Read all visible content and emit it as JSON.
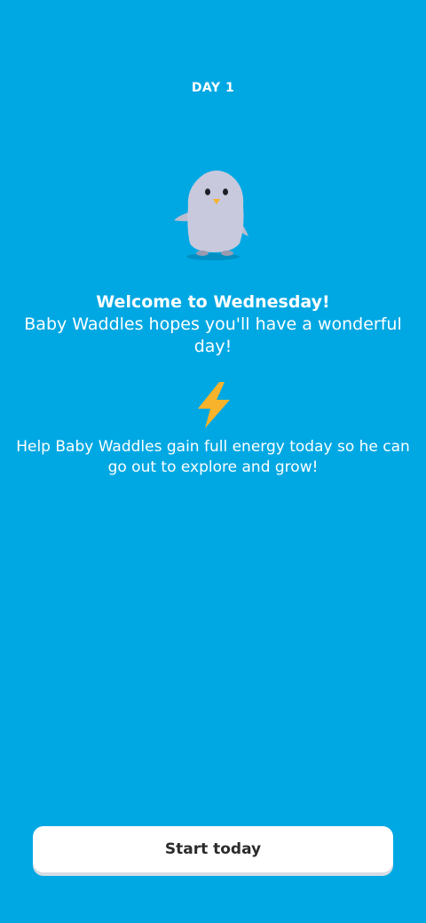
{
  "header": {
    "day_label": "DAY 1"
  },
  "mascot": {
    "icon": "penguin-mascot-icon"
  },
  "welcome": {
    "title": "Welcome to Wednesday!",
    "subtitle": "Baby Waddles hopes you'll have a wonderful day!"
  },
  "energy": {
    "icon": "lightning-bolt-icon",
    "text": "Help Baby Waddles gain full energy today so he can go out to explore and grow!"
  },
  "actions": {
    "start_label": "Start today"
  },
  "colors": {
    "background": "#00a8e3",
    "button_bg": "#ffffff",
    "button_text": "#2b2b2b",
    "bolt": "#f7b32b"
  }
}
